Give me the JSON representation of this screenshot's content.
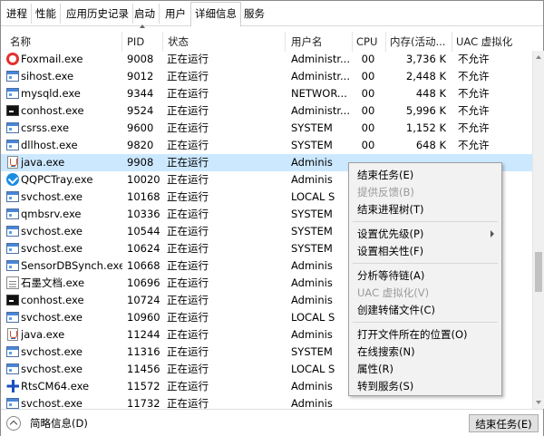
{
  "tabs": [
    "进程",
    "性能",
    "应用历史记录",
    "启动",
    "用户",
    "详细信息",
    "服务"
  ],
  "active_tab": "详细信息",
  "columns": {
    "name": "名称",
    "pid": "PID",
    "status": "状态",
    "user": "用户名",
    "cpu": "CPU",
    "mem": "内存(活动...",
    "uac": "UAC 虚拟化"
  },
  "rows": [
    {
      "name": "Foxmail.exe",
      "pid": "9008",
      "status": "正在运行",
      "user": "Administr...",
      "cpu": "00",
      "mem": "3,736 K",
      "uac": "不允许",
      "icon": "foxmail-icon"
    },
    {
      "name": "sihost.exe",
      "pid": "9012",
      "status": "正在运行",
      "user": "Administr...",
      "cpu": "00",
      "mem": "2,448 K",
      "uac": "不允许",
      "icon": "window-icon"
    },
    {
      "name": "mysqld.exe",
      "pid": "9344",
      "status": "正在运行",
      "user": "NETWOR...",
      "cpu": "00",
      "mem": "448 K",
      "uac": "不允许",
      "icon": "window-icon"
    },
    {
      "name": "conhost.exe",
      "pid": "9524",
      "status": "正在运行",
      "user": "Administr...",
      "cpu": "00",
      "mem": "5,996 K",
      "uac": "不允许",
      "icon": "console-icon"
    },
    {
      "name": "csrss.exe",
      "pid": "9600",
      "status": "正在运行",
      "user": "SYSTEM",
      "cpu": "00",
      "mem": "1,152 K",
      "uac": "不允许",
      "icon": "window-icon"
    },
    {
      "name": "dllhost.exe",
      "pid": "9820",
      "status": "正在运行",
      "user": "SYSTEM",
      "cpu": "00",
      "mem": "648 K",
      "uac": "不允许",
      "icon": "window-icon"
    },
    {
      "name": "java.exe",
      "pid": "9908",
      "status": "正在运行",
      "user": "Adminis",
      "cpu": "",
      "mem": "",
      "uac": "",
      "icon": "java-icon",
      "selected": true
    },
    {
      "name": "QQPCTray.exe",
      "pid": "10020",
      "status": "正在运行",
      "user": "Adminis",
      "cpu": "",
      "mem": "",
      "uac": "",
      "icon": "qq-icon"
    },
    {
      "name": "svchost.exe",
      "pid": "10168",
      "status": "正在运行",
      "user": "LOCAL S",
      "cpu": "",
      "mem": "",
      "uac": "",
      "icon": "window-icon"
    },
    {
      "name": "qmbsrv.exe",
      "pid": "10336",
      "status": "正在运行",
      "user": "SYSTEM",
      "cpu": "",
      "mem": "",
      "uac": "",
      "icon": "window-icon"
    },
    {
      "name": "svchost.exe",
      "pid": "10544",
      "status": "正在运行",
      "user": "SYSTEM",
      "cpu": "",
      "mem": "",
      "uac": "",
      "icon": "window-icon"
    },
    {
      "name": "svchost.exe",
      "pid": "10624",
      "status": "正在运行",
      "user": "SYSTEM",
      "cpu": "",
      "mem": "",
      "uac": "",
      "icon": "window-icon"
    },
    {
      "name": "SensorDBSynch.exe",
      "pid": "10668",
      "status": "正在运行",
      "user": "Adminis",
      "cpu": "",
      "mem": "",
      "uac": "",
      "icon": "window-icon"
    },
    {
      "name": "石墨文档.exe",
      "pid": "10696",
      "status": "正在运行",
      "user": "Adminis",
      "cpu": "",
      "mem": "",
      "uac": "",
      "icon": "document-icon"
    },
    {
      "name": "conhost.exe",
      "pid": "10724",
      "status": "正在运行",
      "user": "Adminis",
      "cpu": "",
      "mem": "",
      "uac": "",
      "icon": "console-icon"
    },
    {
      "name": "svchost.exe",
      "pid": "10960",
      "status": "正在运行",
      "user": "LOCAL S",
      "cpu": "",
      "mem": "",
      "uac": "",
      "icon": "window-icon"
    },
    {
      "name": "java.exe",
      "pid": "11244",
      "status": "正在运行",
      "user": "Adminis",
      "cpu": "",
      "mem": "",
      "uac": "",
      "icon": "java-icon"
    },
    {
      "name": "svchost.exe",
      "pid": "11316",
      "status": "正在运行",
      "user": "SYSTEM",
      "cpu": "",
      "mem": "",
      "uac": "",
      "icon": "window-icon"
    },
    {
      "name": "svchost.exe",
      "pid": "11456",
      "status": "正在运行",
      "user": "LOCAL S",
      "cpu": "",
      "mem": "",
      "uac": "",
      "icon": "window-icon"
    },
    {
      "name": "RtsCM64.exe",
      "pid": "11572",
      "status": "正在运行",
      "user": "Adminis",
      "cpu": "",
      "mem": "",
      "uac": "",
      "icon": "rts-icon"
    },
    {
      "name": "svchost.exe",
      "pid": "11732",
      "status": "正在运行",
      "user": "Adminis",
      "cpu": "",
      "mem": "",
      "uac": "",
      "icon": "window-icon"
    }
  ],
  "context_menu": [
    {
      "label": "结束任务(E)",
      "enabled": true
    },
    {
      "label": "提供反馈(B)",
      "enabled": false
    },
    {
      "label": "结束进程树(T)",
      "enabled": true
    },
    {
      "separator": true
    },
    {
      "label": "设置优先级(P)",
      "enabled": true,
      "submenu": true
    },
    {
      "label": "设置相关性(F)",
      "enabled": true
    },
    {
      "separator": true
    },
    {
      "label": "分析等待链(A)",
      "enabled": true
    },
    {
      "label": "UAC 虚拟化(V)",
      "enabled": false
    },
    {
      "label": "创建转储文件(C)",
      "enabled": true
    },
    {
      "separator": true
    },
    {
      "label": "打开文件所在的位置(O)",
      "enabled": true
    },
    {
      "label": "在线搜索(N)",
      "enabled": true
    },
    {
      "label": "属性(R)",
      "enabled": true
    },
    {
      "label": "转到服务(S)",
      "enabled": true
    }
  ],
  "footer": {
    "details_label": "简略信息(D)",
    "end_task_label": "结束任务(E)"
  }
}
